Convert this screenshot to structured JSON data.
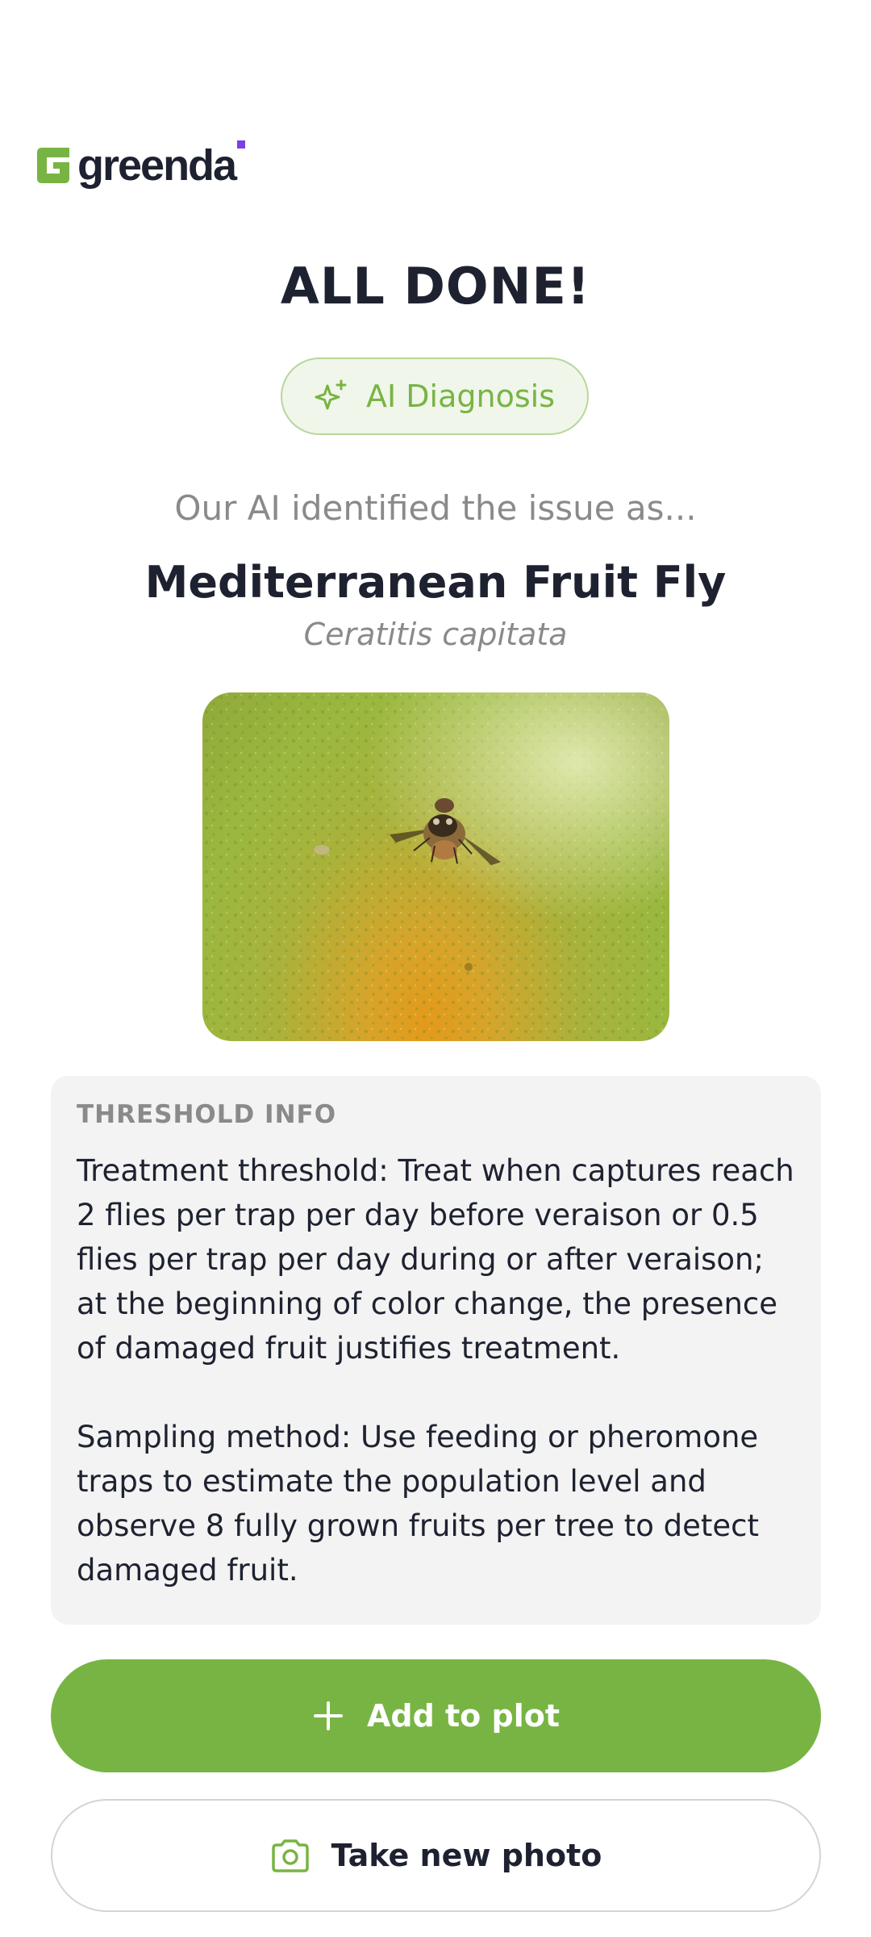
{
  "brand": {
    "name": "greenda",
    "accent_color": "#78b443",
    "dot_color": "#7b3fe4"
  },
  "result": {
    "title": "ALL DONE!",
    "badge_label": "AI Diagnosis",
    "badge_icon": "sparkle-icon",
    "intro": "Our AI identified the issue as...",
    "common_name": "Mediterranean Fruit Fly",
    "scientific_name": "Ceratitis capitata"
  },
  "threshold": {
    "heading": "THRESHOLD INFO",
    "treatment": "Treatment threshold: Treat when captures reach 2 flies per trap per day before veraison or 0.5 flies per trap per day during or after veraison; at the beginning of color change, the presence of damaged fruit justifies treatment.",
    "sampling": "Sampling method: Use feeding or pheromone traps to estimate the population level and observe 8 fully grown fruits per tree to detect damaged fruit."
  },
  "actions": {
    "add_label": "Add to plot",
    "add_icon": "plus-icon",
    "photo_label": "Take new photo",
    "photo_icon": "camera-icon"
  }
}
